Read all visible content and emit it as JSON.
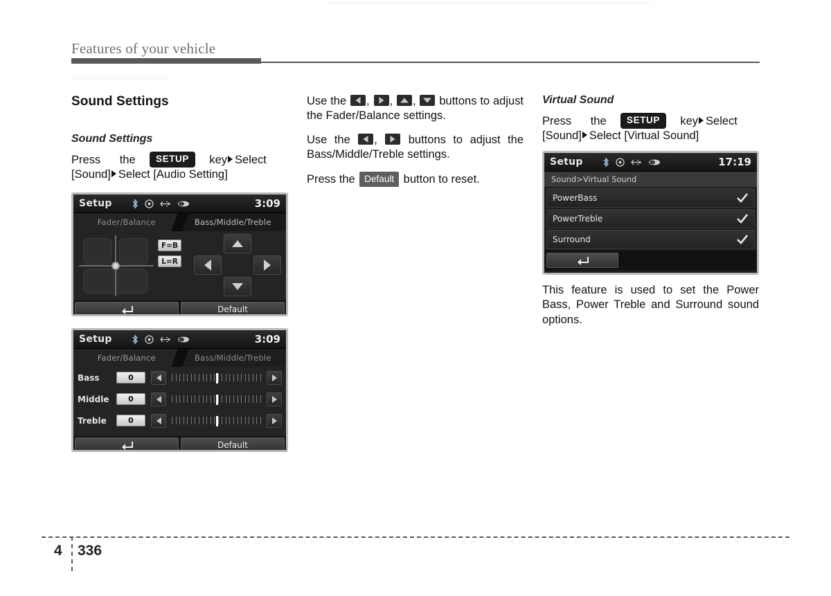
{
  "header": {
    "title": "Features of your vehicle"
  },
  "footer": {
    "chapter": "4",
    "page": "336"
  },
  "col_left": {
    "section_title": "Sound Settings",
    "sub_title": "Sound Settings",
    "instr_pre": "Press",
    "instr_the": "the",
    "key_label": "SETUP",
    "instr_key": "key",
    "instr_select": "Select",
    "instr_line2": "[Sound]",
    "instr_line2b": "Select [Audio Setting]"
  },
  "col_mid": {
    "p1_a": "Use the",
    "p1_b": "buttons to adjust the Fader/Balance settings.",
    "p2_a": "Use the",
    "p2_b": "buttons to adjust the Bass/Middle/Treble settings.",
    "p3_a": "Press the",
    "p3_key": "Default",
    "p3_b": "button to reset."
  },
  "col_right": {
    "sub_title": "Virtual Sound",
    "instr_pre": "Press",
    "instr_the": "the",
    "key_label": "SETUP",
    "instr_key": "key",
    "instr_select": "Select",
    "instr_line2": "[Sound]",
    "instr_line2b": "Select [Virtual Sound]",
    "caption": "This feature is used to set the Power Bass, Power Treble and Surround sound options."
  },
  "screen_fader": {
    "title": "Setup",
    "clock": "3:09",
    "icons": [
      "bluetooth-icon",
      "disc-icon",
      "usb-icon",
      "aux-icon"
    ],
    "tab_active": "Fader/Balance",
    "tab_inactive": "Bass/Middle/Treble",
    "eq_buttons": [
      "F=B",
      "L=R"
    ],
    "dpad": [
      "up-arrow",
      "down-arrow",
      "left-arrow",
      "right-arrow"
    ],
    "back_label": "back-icon",
    "default_label": "Default"
  },
  "screen_eq": {
    "title": "Setup",
    "clock": "3:09",
    "tab_inactive": "Fader/Balance",
    "tab_active": "Bass/Middle/Treble",
    "rows": [
      {
        "label": "Bass",
        "value": "0"
      },
      {
        "label": "Middle",
        "value": "0"
      },
      {
        "label": "Treble",
        "value": "0"
      }
    ],
    "back_label": "back-icon",
    "default_label": "Default"
  },
  "screen_virtual": {
    "title": "Setup",
    "clock": "17:19",
    "breadcrumb": "Sound>Virtual Sound",
    "rows": [
      {
        "label": "PowerBass",
        "checked": true
      },
      {
        "label": "PowerTreble",
        "checked": true
      },
      {
        "label": "Surround",
        "checked": true
      }
    ],
    "back_label": "back-icon"
  },
  "colors": {
    "header_bar": "#5a5a5a",
    "screen_bg": "#242424",
    "badge_dark": "#1b1b1b",
    "badge_gray": "#5e5e5e"
  }
}
